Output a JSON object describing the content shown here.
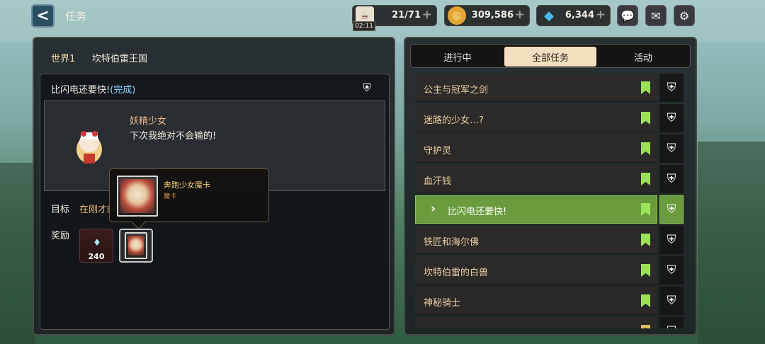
{
  "header": {
    "back_label": "<",
    "title": "任务",
    "resources": [
      {
        "name": "stamina",
        "value": "21/71",
        "timer": "02:11",
        "icon": "coffee-cup-icon"
      },
      {
        "name": "gold",
        "value": "309,586",
        "icon": "gold-coin-icon"
      },
      {
        "name": "gems",
        "value": "6,344",
        "icon": "gem-icon"
      }
    ],
    "buttons": [
      "chat-icon",
      "mail-icon",
      "settings-gear-icon"
    ]
  },
  "left": {
    "world": "世界1",
    "region": "坎特伯雷王国",
    "quest_title": "比闪电还要快!",
    "quest_status": "(完成)",
    "npc_name": "妖精少女",
    "npc_line": "下次我绝对不会输的!",
    "goal_label": "目标",
    "goal_text": "在刚才的",
    "reward_label": "奖励",
    "reward_crystal_qty": "240",
    "tooltip_title": "奔跑少女魔卡",
    "tooltip_sub": "魔卡"
  },
  "tabs": [
    {
      "label": "进行中",
      "active": false
    },
    {
      "label": "全部任务",
      "active": true
    },
    {
      "label": "活动",
      "active": false
    }
  ],
  "quests": [
    {
      "title": "公主与冠军之剑",
      "selected": false
    },
    {
      "title": "迷路的少女…?",
      "selected": false
    },
    {
      "title": "守护灵",
      "selected": false
    },
    {
      "title": "血汗钱",
      "selected": false
    },
    {
      "title": "比闪电还要快!",
      "selected": true
    },
    {
      "title": "铁匠和海尔佛",
      "selected": false
    },
    {
      "title": "坎特伯雷的白兽",
      "selected": false
    },
    {
      "title": "神秘骑士",
      "selected": false
    },
    {
      "title": "",
      "selected": false
    }
  ],
  "colors": {
    "selected_row": "#6a9c3e",
    "flag": "#9be15a",
    "accent_done": "#8ed8ff"
  }
}
